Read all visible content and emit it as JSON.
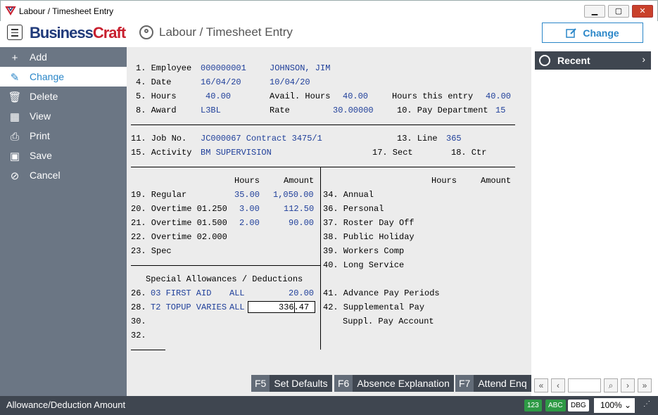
{
  "window": {
    "title": "Labour / Timesheet Entry",
    "min": "▁",
    "max": "▢",
    "close": "✕"
  },
  "header": {
    "logo_business": "Business",
    "logo_craft": "Craft",
    "title": "Labour / Timesheet Entry",
    "change_label": "Change"
  },
  "sidebar": {
    "items": [
      {
        "label": "Add",
        "icon": "plus-icon"
      },
      {
        "label": "Change",
        "icon": "edit-icon"
      },
      {
        "label": "Delete",
        "icon": "trash-icon"
      },
      {
        "label": "View",
        "icon": "table-icon"
      },
      {
        "label": "Print",
        "icon": "printer-icon"
      },
      {
        "label": "Save",
        "icon": "save-icon"
      },
      {
        "label": "Cancel",
        "icon": "cancel-icon"
      }
    ]
  },
  "recent": {
    "label": "Recent"
  },
  "form": {
    "employee_label": "1. Employee",
    "employee_code": "000000001",
    "employee_name": "JOHNSON, JIM",
    "date_label": "4. Date",
    "date": "16/04/20",
    "date2": "10/04/20",
    "hours_label": "5. Hours",
    "hours": "40.00",
    "avail_label": "Avail. Hours",
    "avail": "40.00",
    "hours_entry_label": "Hours this entry",
    "hours_entry": "40.00",
    "award_label": "8. Award",
    "award": "L3BL",
    "rate_label": "Rate",
    "rate": "30.00000",
    "paydept_label": "10. Pay Department",
    "paydept": "15",
    "job_label": "11. Job No.",
    "job": "JC000067 Contract 3475/1",
    "line_label": "13. Line",
    "line": "365",
    "activity_label": "15. Activity",
    "activity": "BM SUPERVISION",
    "sect_label": "17. Sect",
    "ctr_label": "18. Ctr",
    "hours_head": "Hours",
    "amount_head": "Amount",
    "rows": [
      {
        "label": "19. Regular",
        "hours": "35.00",
        "amount": "1,050.00"
      },
      {
        "label": "20. Overtime 01.250",
        "hours": "3.00",
        "amount": "112.50"
      },
      {
        "label": "21. Overtime 01.500",
        "hours": "2.00",
        "amount": "90.00"
      },
      {
        "label": "22. Overtime 02.000",
        "hours": "",
        "amount": ""
      },
      {
        "label": "23. Spec",
        "hours": "",
        "amount": ""
      }
    ],
    "right_rows": [
      "34. Annual",
      "36. Personal",
      "37. Roster Day Off",
      "38. Public Holiday",
      "39. Workers Comp",
      "40. Long Service"
    ],
    "allow_title": "Special Allowances / Deductions",
    "allow_rows": [
      {
        "num": "26.",
        "desc": "03 FIRST AID",
        "who": "ALL",
        "amount": "20.00"
      },
      {
        "num": "28.",
        "desc": "T2 TOPUP VARIES",
        "who": "ALL",
        "amount": "336.47"
      },
      {
        "num": "30.",
        "desc": "",
        "who": "",
        "amount": ""
      },
      {
        "num": "32.",
        "desc": "",
        "who": "",
        "amount": ""
      }
    ],
    "advance_label": "41. Advance Pay Periods",
    "supp_label": "42. Supplemental Pay",
    "supp_acct_label": "Suppl. Pay Account"
  },
  "fkeys": [
    {
      "key": "F5",
      "label": "Set Defaults"
    },
    {
      "key": "F6",
      "label": "Absence Explanation"
    },
    {
      "key": "F7",
      "label": "Attend Enq"
    }
  ],
  "status": {
    "text": "Allowance/Deduction Amount",
    "b123": "123",
    "abc": "ABC",
    "dbg": "DBG",
    "zoom": "100%"
  }
}
